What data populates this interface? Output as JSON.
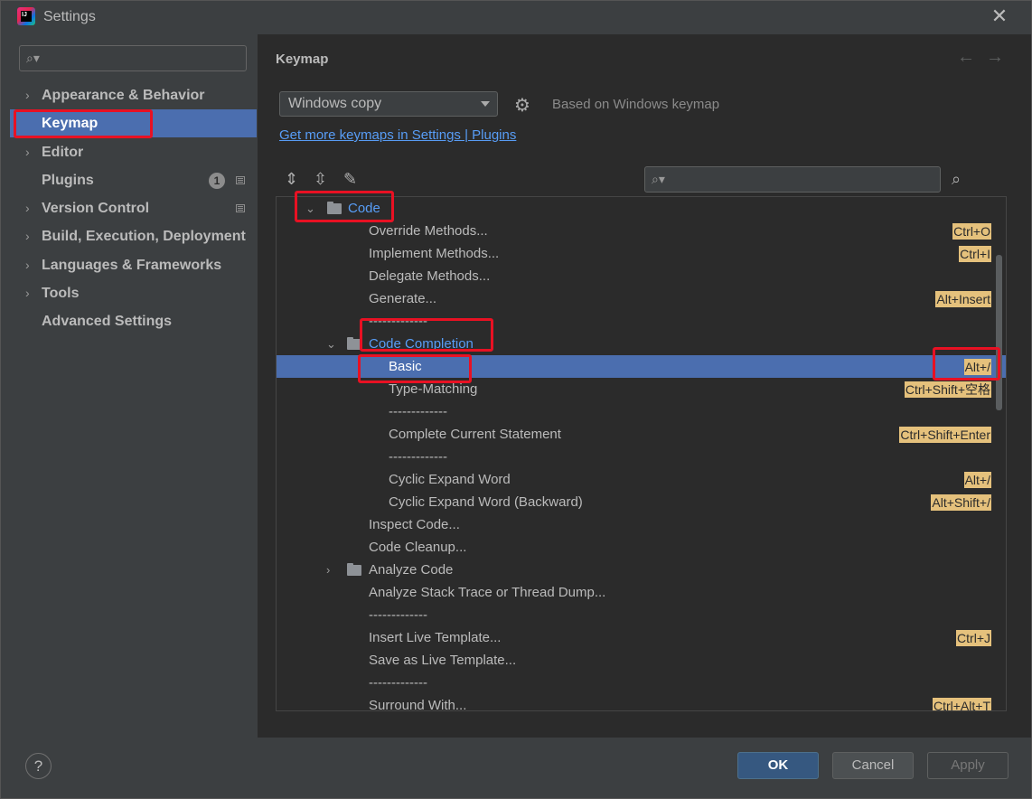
{
  "window": {
    "title": "Settings"
  },
  "sidebar": {
    "search_placeholder": "",
    "items": [
      {
        "label": "Appearance & Behavior",
        "expandable": true
      },
      {
        "label": "Keymap",
        "expandable": false,
        "selected": true
      },
      {
        "label": "Editor",
        "expandable": true
      },
      {
        "label": "Plugins",
        "expandable": false,
        "badge": "1"
      },
      {
        "label": "Version Control",
        "expandable": true
      },
      {
        "label": "Build, Execution, Deployment",
        "expandable": true
      },
      {
        "label": "Languages & Frameworks",
        "expandable": true
      },
      {
        "label": "Tools",
        "expandable": true
      },
      {
        "label": "Advanced Settings",
        "expandable": false
      }
    ]
  },
  "main": {
    "title": "Keymap",
    "keymap_select": "Windows copy",
    "based_on": "Based on Windows keymap",
    "plugins_link": "Get more keymaps in Settings | Plugins",
    "tree": [
      {
        "label": "Code",
        "shortcut": ""
      },
      {
        "label": "Override Methods...",
        "shortcut": "Ctrl+O"
      },
      {
        "label": "Implement Methods...",
        "shortcut": "Ctrl+I"
      },
      {
        "label": "Delegate Methods...",
        "shortcut": ""
      },
      {
        "label": "Generate...",
        "shortcut": "Alt+Insert"
      },
      {
        "label": "-------------",
        "shortcut": ""
      },
      {
        "label": "Code Completion",
        "shortcut": ""
      },
      {
        "label": "Basic",
        "shortcut": "Alt+/"
      },
      {
        "label": "Type-Matching",
        "shortcut": "Ctrl+Shift+空格"
      },
      {
        "label": "-------------",
        "shortcut": ""
      },
      {
        "label": "Complete Current Statement",
        "shortcut": "Ctrl+Shift+Enter"
      },
      {
        "label": "-------------",
        "shortcut": ""
      },
      {
        "label": "Cyclic Expand Word",
        "shortcut": "Alt+/"
      },
      {
        "label": "Cyclic Expand Word (Backward)",
        "shortcut": "Alt+Shift+/"
      },
      {
        "label": "Inspect Code...",
        "shortcut": ""
      },
      {
        "label": "Code Cleanup...",
        "shortcut": ""
      },
      {
        "label": "Analyze Code",
        "shortcut": ""
      },
      {
        "label": "Analyze Stack Trace or Thread Dump...",
        "shortcut": ""
      },
      {
        "label": "-------------",
        "shortcut": ""
      },
      {
        "label": "Insert Live Template...",
        "shortcut": "Ctrl+J"
      },
      {
        "label": "Save as Live Template...",
        "shortcut": ""
      },
      {
        "label": "-------------",
        "shortcut": ""
      },
      {
        "label": "Surround With...",
        "shortcut": "Ctrl+Alt+T"
      }
    ]
  },
  "footer": {
    "help": "?",
    "ok": "OK",
    "cancel": "Cancel",
    "apply": "Apply"
  },
  "colors": {
    "accent": "#4b6eaf",
    "shortcut_bg": "#e5c17c",
    "link": "#589df6",
    "highlight_box": "#e81123"
  },
  "icons": [
    "app-icon",
    "close-icon",
    "search-icon",
    "chevron-right-icon",
    "chevron-down-icon",
    "folder-icon",
    "gear-icon",
    "expand-all-icon",
    "collapse-all-icon",
    "edit-icon",
    "find-shortcut-icon",
    "help-icon",
    "back-arrow-icon",
    "forward-arrow-icon"
  ]
}
